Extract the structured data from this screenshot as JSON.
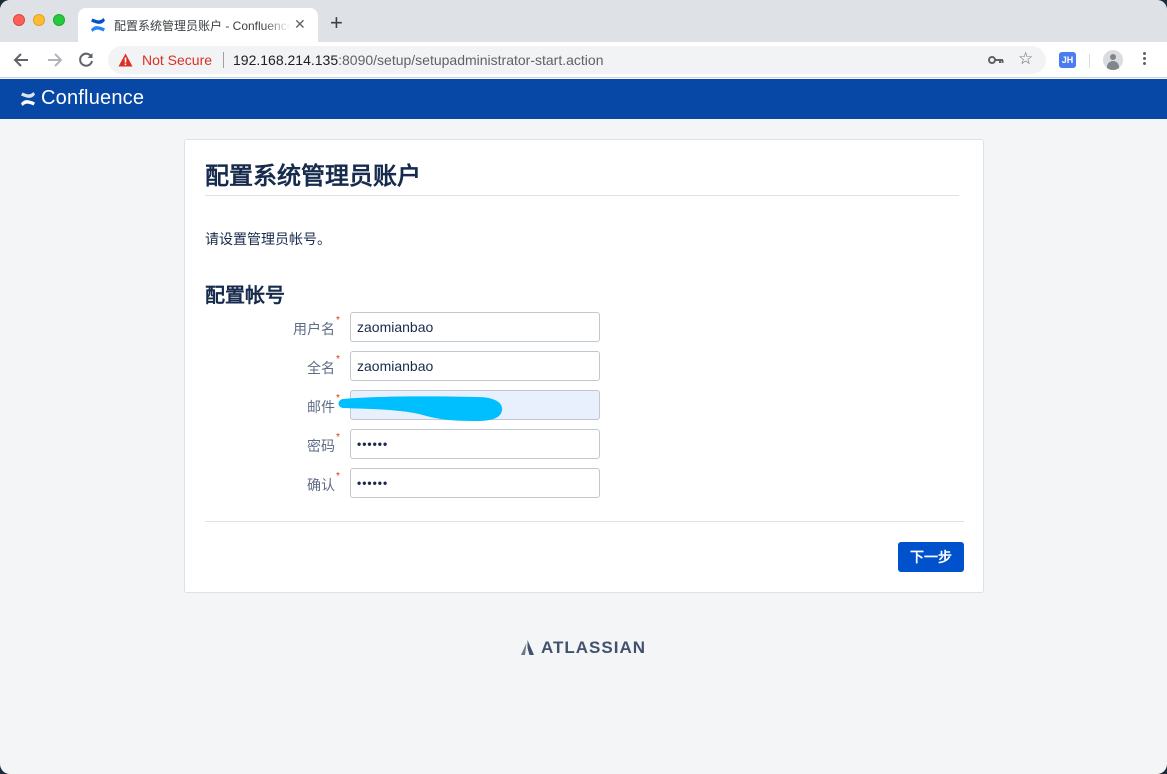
{
  "browser": {
    "tab": {
      "title": "配置系统管理员账户 - Confluence",
      "close_glyph": "✕"
    },
    "new_tab_glyph": "+",
    "security_label": "Not Secure",
    "url": {
      "host": "192.168.214.135",
      "rest": ":8090/setup/setupadministrator-start.action"
    },
    "extension_label": "JH",
    "star_glyph": "☆"
  },
  "app": {
    "name": "Confluence",
    "brand_color": "#0747a6"
  },
  "page": {
    "title": "配置系统管理员账户",
    "intro": "请设置管理员帐号。",
    "section_title": "配置帐号",
    "required_marker": "*",
    "fields": [
      {
        "label": "用户名",
        "value": "zaomianbao",
        "type": "text"
      },
      {
        "label": "全名",
        "value": "zaomianbao",
        "type": "text"
      },
      {
        "label": "邮件",
        "value": "",
        "type": "email",
        "redacted": true
      },
      {
        "label": "密码",
        "value": "••••••",
        "type": "password"
      },
      {
        "label": "确认",
        "value": "••••••",
        "type": "password"
      }
    ],
    "next_button": "下一步",
    "button_color": "#0052cc"
  },
  "footer": {
    "brand": "ATLASSIAN"
  }
}
